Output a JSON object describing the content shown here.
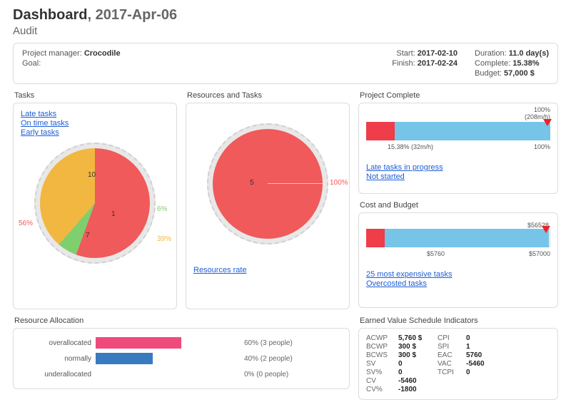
{
  "header": {
    "title_bold": "Dashboard",
    "title_suffix": ", 2017-Apr-06",
    "subtitle": "Audit",
    "pm_label": "Project manager:",
    "pm_value": "Crocodile",
    "goal_label": "Goal:",
    "goal_value": "",
    "start_label": "Start:",
    "start_value": "2017-02-10",
    "finish_label": "Finish:",
    "finish_value": "2017-02-24",
    "duration_label": "Duration:",
    "duration_value": "11.0 day(s)",
    "complete_label": "Complete:",
    "complete_value": "15.38%",
    "budget_label": "Budget:",
    "budget_value": "57,000 $"
  },
  "tasks": {
    "title": "Tasks",
    "links": [
      "Late tasks",
      "On time tasks",
      "Early tasks"
    ]
  },
  "resources": {
    "title": "Resources and Tasks",
    "link": "Resources rate"
  },
  "project_complete": {
    "title": "Project Complete",
    "top_right1": "100%",
    "top_right2": "(208m/h)",
    "under_left": "15.38% (32m/h)",
    "under_right": "100%",
    "links": [
      "Late tasks in progress",
      "Not started"
    ]
  },
  "cost_budget": {
    "title": "Cost and Budget",
    "top_marker": "$56528",
    "under_left": "$5760",
    "under_right": "$57000",
    "links": [
      "25 most expensive tasks",
      "Overcosted tasks"
    ]
  },
  "evm": {
    "title": "Earned Value Schedule Indicators",
    "rows": [
      [
        "ACWP",
        "5,760 $",
        "CPI",
        "0"
      ],
      [
        "BCWP",
        "300 $",
        "SPI",
        "1"
      ],
      [
        "BCWS",
        "300 $",
        "EAC",
        "5760"
      ],
      [
        "SV",
        "0",
        "VAC",
        "-5460"
      ],
      [
        "SV%",
        "0",
        "TCPI",
        "0"
      ],
      [
        "CV",
        "-5460",
        "",
        ""
      ],
      [
        "CV%",
        "-1800",
        "",
        ""
      ]
    ]
  },
  "alloc": {
    "title": "Resource Allocation",
    "rows": [
      {
        "label": "overallocated",
        "pct": 60,
        "color": "#ef4a7b",
        "info": "60% (3 people)"
      },
      {
        "label": "normally",
        "pct": 40,
        "color": "#3a7bbf",
        "info": "40% (2 people)"
      },
      {
        "label": "underallocated",
        "pct": 0,
        "color": "#999",
        "info": "0% (0 people)"
      }
    ]
  },
  "chart_data": [
    {
      "type": "pie",
      "title": "Tasks",
      "series": [
        {
          "name": "Late tasks",
          "value": 10,
          "percent": 56,
          "color": "#f05a5a"
        },
        {
          "name": "On time tasks",
          "value": 7,
          "percent": 39,
          "color": "#f1b740"
        },
        {
          "name": "Early tasks",
          "value": 1,
          "percent": 6,
          "color": "#7fcf6e"
        }
      ]
    },
    {
      "type": "pie",
      "title": "Resources and Tasks",
      "series": [
        {
          "name": "Resources rate",
          "value": 5,
          "percent": 100,
          "color": "#f05a5a"
        }
      ]
    },
    {
      "type": "bar",
      "title": "Project Complete",
      "categories": [
        "progress"
      ],
      "series": [
        {
          "name": "late",
          "values": [
            15.38
          ],
          "color": "#ef3d49"
        },
        {
          "name": "remaining-to-100",
          "values": [
            84.62
          ],
          "color": "#76c5e8"
        }
      ],
      "xlim": [
        0,
        100
      ],
      "unit": "%",
      "total_label": "208m/h",
      "progress_label": "32m/h"
    },
    {
      "type": "bar",
      "title": "Cost and Budget",
      "categories": [
        "budget"
      ],
      "series": [
        {
          "name": "spent-red",
          "values": [
            5760
          ],
          "color": "#ef3d49"
        },
        {
          "name": "spent-blue",
          "values": [
            50768
          ],
          "color": "#76c5e8"
        }
      ],
      "xlim": [
        0,
        57000
      ],
      "marker": 56528,
      "unit": "$"
    },
    {
      "type": "bar",
      "title": "Resource Allocation",
      "categories": [
        "overallocated",
        "normally",
        "underallocated"
      ],
      "values": [
        60,
        40,
        0
      ],
      "people": [
        3,
        2,
        0
      ],
      "colors": [
        "#ef4a7b",
        "#3a7bbf",
        "#999"
      ],
      "unit": "%"
    }
  ]
}
